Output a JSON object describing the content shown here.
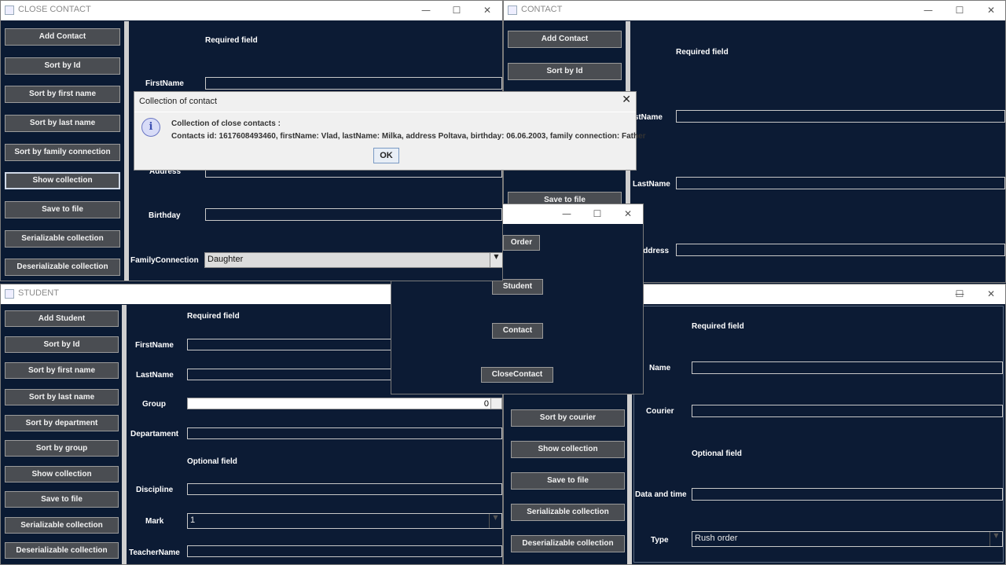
{
  "window_controls": {
    "minimize": "—",
    "maximize": "☐",
    "close": "✕"
  },
  "close_contact": {
    "title": "CLOSE CONTACT",
    "buttons": [
      "Add Contact",
      "Sort by Id",
      "Sort by first name",
      "Sort by last name",
      "Sort by family connection",
      "Show collection",
      "Save to file",
      "Serializable collection",
      "Deserializable collection"
    ],
    "required_label": "Required field",
    "labels": {
      "first_name": "FirstName",
      "address": "Address",
      "birthday": "Birthday",
      "family_connection": "FamilyConnection"
    },
    "family_connection_value": "Daughter"
  },
  "contact": {
    "title": "CONTACT",
    "buttons": [
      "Add Contact",
      "Sort by Id",
      "Save to file"
    ],
    "required_label": "Required field",
    "labels": {
      "first_name": "FirstName",
      "last_name": "LastName",
      "address": "Address"
    }
  },
  "menu": {
    "buttons": [
      "Order",
      "Student",
      "Contact",
      "CloseContact"
    ]
  },
  "student": {
    "title": "STUDENT",
    "buttons": [
      "Add Student",
      "Sort by Id",
      "Sort by first name",
      "Sort by last name",
      "Sort by department",
      "Sort by group",
      "Show collection",
      "Save to file",
      "Serializable collection",
      "Deserializable collection"
    ],
    "required_label": "Required field",
    "optional_label": "Optional field",
    "labels": {
      "first_name": "FirstName",
      "last_name": "LastName",
      "group": "Group",
      "department": "Departament",
      "discipline": "Discipline",
      "mark": "Mark",
      "teacher_name": "TeacherName"
    },
    "group_value": "0",
    "mark_value": "1"
  },
  "order": {
    "buttons": [
      "Sort by courier",
      "Show collection",
      "Save to file",
      "Serializable collection",
      "Deserializable collection"
    ],
    "required_label": "Required field",
    "optional_label": "Optional field",
    "labels": {
      "name": "Name",
      "courier": "Courier",
      "date_time": "Data and time",
      "type": "Type"
    },
    "type_value": "Rush order"
  },
  "dialog": {
    "title": "Collection of contact",
    "heading": "Collection of close contacts :",
    "message": "Contacts id: 1617608493460, firstName: Vlad, lastName: Milka, address Poltava, birthday: 06.06.2003, family connection: Father",
    "ok_label": "OK",
    "close": "✕",
    "info_glyph": "i"
  }
}
